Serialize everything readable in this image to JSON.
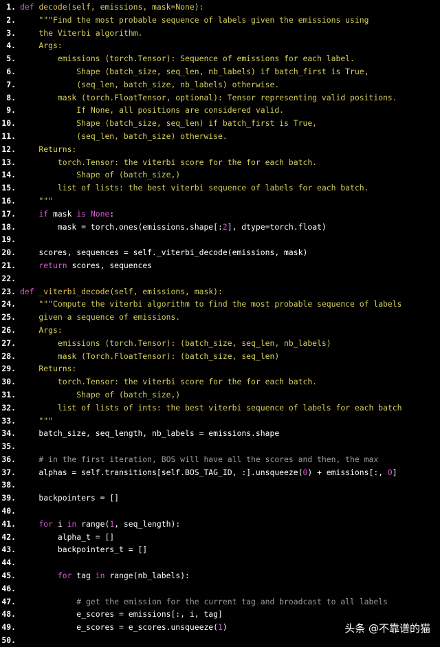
{
  "colors": {
    "background": "#000000",
    "keyword": "#d65bd2",
    "function_name": "#e5c15c",
    "string": "#d7d15c",
    "comment": "#9d9d9d",
    "text": "#ffffff"
  },
  "watermark": "头条 @不靠谱的猫",
  "lines": [
    {
      "n": "1.",
      "tokens": [
        [
          "kw",
          "def "
        ],
        [
          "fn",
          "decode"
        ],
        [
          "str",
          "(self, emissions, mask=None):"
        ]
      ]
    },
    {
      "n": "2.",
      "tokens": [
        [
          "str",
          "    \"\"\"Find the most probable sequence of labels given the emissions using"
        ]
      ]
    },
    {
      "n": "3.",
      "tokens": [
        [
          "str",
          "    the Viterbi algorithm."
        ]
      ]
    },
    {
      "n": "4.",
      "tokens": [
        [
          "str",
          "    Args:"
        ]
      ]
    },
    {
      "n": "5.",
      "tokens": [
        [
          "str",
          "        emissions (torch.Tensor): Sequence of emissions for each label."
        ]
      ]
    },
    {
      "n": "6.",
      "tokens": [
        [
          "str",
          "            Shape (batch_size, seq_len, nb_labels) if batch_first is True,"
        ]
      ]
    },
    {
      "n": "7.",
      "tokens": [
        [
          "str",
          "            (seq_len, batch_size, nb_labels) otherwise."
        ]
      ]
    },
    {
      "n": "8.",
      "tokens": [
        [
          "str",
          "        mask (torch.FloatTensor, optional): Tensor representing valid positions."
        ]
      ]
    },
    {
      "n": "9.",
      "tokens": [
        [
          "str",
          "            If None, all positions are considered valid."
        ]
      ]
    },
    {
      "n": "10.",
      "tokens": [
        [
          "str",
          "            Shape (batch_size, seq_len) if batch_first is True,"
        ]
      ]
    },
    {
      "n": "11.",
      "tokens": [
        [
          "str",
          "            (seq_len, batch_size) otherwise."
        ]
      ]
    },
    {
      "n": "12.",
      "tokens": [
        [
          "str",
          "    Returns:"
        ]
      ]
    },
    {
      "n": "13.",
      "tokens": [
        [
          "str",
          "        torch.Tensor: the viterbi score for the for each batch."
        ]
      ]
    },
    {
      "n": "14.",
      "tokens": [
        [
          "str",
          "            Shape of (batch_size,)"
        ]
      ]
    },
    {
      "n": "15.",
      "tokens": [
        [
          "str",
          "        list of lists: the best viterbi sequence of labels for each batch."
        ]
      ]
    },
    {
      "n": "16.",
      "tokens": [
        [
          "str",
          "    \"\"\""
        ]
      ]
    },
    {
      "n": "17.",
      "tokens": [
        [
          "plain",
          "    "
        ],
        [
          "kw",
          "if"
        ],
        [
          "plain",
          " mask "
        ],
        [
          "kw",
          "is"
        ],
        [
          "plain",
          " "
        ],
        [
          "kw",
          "None"
        ],
        [
          "plain",
          ":"
        ]
      ]
    },
    {
      "n": "18.",
      "tokens": [
        [
          "plain",
          "        mask = torch.ones(emissions.shape[:"
        ],
        [
          "num",
          "2"
        ],
        [
          "plain",
          "], dtype=torch.float)"
        ]
      ]
    },
    {
      "n": "19.",
      "tokens": []
    },
    {
      "n": "20.",
      "tokens": [
        [
          "plain",
          "    scores, sequences = self._viterbi_decode(emissions, mask)"
        ]
      ]
    },
    {
      "n": "21.",
      "tokens": [
        [
          "plain",
          "    "
        ],
        [
          "kw",
          "return"
        ],
        [
          "plain",
          " scores, sequences"
        ]
      ]
    },
    {
      "n": "22.",
      "tokens": []
    },
    {
      "n": "23.",
      "tokens": [
        [
          "kw",
          "def "
        ],
        [
          "fn",
          "_viterbi_decode"
        ],
        [
          "str",
          "(self, emissions, mask):"
        ]
      ]
    },
    {
      "n": "24.",
      "tokens": [
        [
          "str",
          "    \"\"\"Compute the viterbi algorithm to find the most probable sequence of labels"
        ]
      ]
    },
    {
      "n": "25.",
      "tokens": [
        [
          "str",
          "    given a sequence of emissions."
        ]
      ]
    },
    {
      "n": "26.",
      "tokens": [
        [
          "str",
          "    Args:"
        ]
      ]
    },
    {
      "n": "27.",
      "tokens": [
        [
          "str",
          "        emissions (torch.Tensor): (batch_size, seq_len, nb_labels)"
        ]
      ]
    },
    {
      "n": "28.",
      "tokens": [
        [
          "str",
          "        mask (Torch.FloatTensor): (batch_size, seq_len)"
        ]
      ]
    },
    {
      "n": "29.",
      "tokens": [
        [
          "str",
          "    Returns:"
        ]
      ]
    },
    {
      "n": "30.",
      "tokens": [
        [
          "str",
          "        torch.Tensor: the viterbi score for the for each batch."
        ]
      ]
    },
    {
      "n": "31.",
      "tokens": [
        [
          "str",
          "            Shape of (batch_size,)"
        ]
      ]
    },
    {
      "n": "32.",
      "tokens": [
        [
          "str",
          "        list of lists of ints: the best viterbi sequence of labels for each batch"
        ]
      ]
    },
    {
      "n": "33.",
      "tokens": [
        [
          "str",
          "    \"\"\""
        ]
      ]
    },
    {
      "n": "34.",
      "tokens": [
        [
          "plain",
          "    batch_size, seq_length, nb_labels = emissions.shape"
        ]
      ]
    },
    {
      "n": "35.",
      "tokens": []
    },
    {
      "n": "36.",
      "tokens": [
        [
          "cm",
          "    # in the first iteration, BOS will have all the scores and then, the max"
        ]
      ]
    },
    {
      "n": "37.",
      "tokens": [
        [
          "plain",
          "    alphas = self.transitions[self.BOS_TAG_ID, :].unsqueeze("
        ],
        [
          "num",
          "0"
        ],
        [
          "plain",
          ") + emissions[:, "
        ],
        [
          "num",
          "0"
        ],
        [
          "plain",
          "]"
        ]
      ]
    },
    {
      "n": "38.",
      "tokens": []
    },
    {
      "n": "39.",
      "tokens": [
        [
          "plain",
          "    backpointers = []"
        ]
      ]
    },
    {
      "n": "40.",
      "tokens": []
    },
    {
      "n": "41.",
      "tokens": [
        [
          "plain",
          "    "
        ],
        [
          "kw",
          "for"
        ],
        [
          "plain",
          " i "
        ],
        [
          "kw",
          "in"
        ],
        [
          "plain",
          " range("
        ],
        [
          "num",
          "1"
        ],
        [
          "plain",
          ", seq_length):"
        ]
      ]
    },
    {
      "n": "42.",
      "tokens": [
        [
          "plain",
          "        alpha_t = []"
        ]
      ]
    },
    {
      "n": "43.",
      "tokens": [
        [
          "plain",
          "        backpointers_t = []"
        ]
      ]
    },
    {
      "n": "44.",
      "tokens": []
    },
    {
      "n": "45.",
      "tokens": [
        [
          "plain",
          "        "
        ],
        [
          "kw",
          "for"
        ],
        [
          "plain",
          " tag "
        ],
        [
          "kw",
          "in"
        ],
        [
          "plain",
          " range(nb_labels):"
        ]
      ]
    },
    {
      "n": "46.",
      "tokens": []
    },
    {
      "n": "47.",
      "tokens": [
        [
          "cm",
          "            # get the emission for the current tag and broadcast to all labels"
        ]
      ]
    },
    {
      "n": "48.",
      "tokens": [
        [
          "plain",
          "            e_scores = emissions[:, i, tag]"
        ]
      ]
    },
    {
      "n": "49.",
      "tokens": [
        [
          "plain",
          "            e_scores = e_scores.unsqueeze("
        ],
        [
          "num",
          "1"
        ],
        [
          "plain",
          ")"
        ]
      ]
    },
    {
      "n": "50.",
      "tokens": []
    }
  ]
}
